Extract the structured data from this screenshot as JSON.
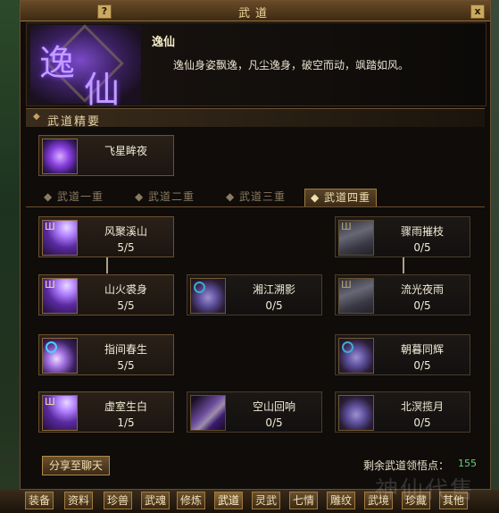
{
  "window": {
    "title": "武道",
    "help_label": "?",
    "close_label": "x"
  },
  "header": {
    "emblem_chars": [
      "逸",
      "仙"
    ],
    "name": "逸仙",
    "description": "逸仙身姿飘逸，凡尘逸身，破空而动，飒踏如风。"
  },
  "essentials": {
    "title": "武道精要",
    "skill": {
      "name": "飞星眸夜",
      "icon": "running-figure-icon"
    }
  },
  "tabs": [
    {
      "label": "武道一重",
      "active": false
    },
    {
      "label": "武道二重",
      "active": false
    },
    {
      "label": "武道三重",
      "active": false
    },
    {
      "label": "武道四重",
      "active": true
    }
  ],
  "skills": [
    {
      "name": "风聚溪山",
      "level": "5/5",
      "icon": "violet-strike-icon"
    },
    {
      "name": "骤雨摧枝",
      "level": "0/5",
      "icon": "grey-claw-icon"
    },
    {
      "name": "山火裘身",
      "level": "5/5",
      "icon": "violet-strike-icon"
    },
    {
      "name": "湘江溯影",
      "level": "0/5",
      "icon": "dark-swirl-icon"
    },
    {
      "name": "流光夜雨",
      "level": "0/5",
      "icon": "grey-claw-icon"
    },
    {
      "name": "指间春生",
      "level": "5/5",
      "icon": "violet-orb-icon"
    },
    {
      "name": "朝暮同辉",
      "level": "0/5",
      "icon": "swirl-icon"
    },
    {
      "name": "虚室生白",
      "level": "1/5",
      "icon": "violet-strike-icon"
    },
    {
      "name": "空山回响",
      "level": "0/5",
      "icon": "dark-strike-icon"
    },
    {
      "name": "北溟揽月",
      "level": "0/5",
      "icon": "swirl-icon"
    }
  ],
  "share_button": "分享至聊天",
  "points": {
    "label": "剩余武道领悟点：",
    "value": "155"
  },
  "bottom_tabs": [
    "装备",
    "资料",
    "珍兽",
    "武魂",
    "修炼",
    "武道",
    "灵武",
    "七情",
    "雕纹",
    "武境",
    "珍藏",
    "其他"
  ],
  "bottom_active": "武道",
  "watermark": "神仙代售"
}
